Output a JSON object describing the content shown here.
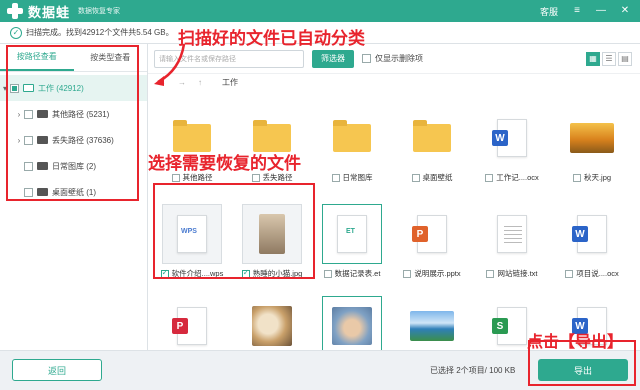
{
  "titlebar": {
    "app_name": "数据蛙",
    "app_subtitle": "数据恢复专家",
    "service_label": "客服",
    "menu_icon": "menu-icon",
    "minimize_icon": "minimize-icon",
    "close_icon": "close-icon"
  },
  "status": {
    "text": "扫描完成。找到42912个文件共5.54 GB。"
  },
  "sidebar": {
    "tabs": [
      "按路径查看",
      "按类型查看"
    ],
    "active_tab": "按路径查看",
    "root": {
      "label": "工作 (42912)"
    },
    "items": [
      {
        "label": "其他路径 (5231)",
        "expandable": true
      },
      {
        "label": "丢失路径 (37636)",
        "expandable": true
      },
      {
        "label": "日常图库 (2)",
        "expandable": false
      },
      {
        "label": "桌面壁纸 (1)",
        "expandable": false
      }
    ]
  },
  "toolbar": {
    "search_placeholder": "请输入文件名或保存路径",
    "filter_label": "筛选器",
    "only_deleted_label": "仅显示删除项",
    "views": [
      "grid-view-icon",
      "list-view-icon",
      "detail-view-icon"
    ]
  },
  "pathbar": {
    "current": "工作"
  },
  "files": [
    {
      "name": "其他路径",
      "type": "folder"
    },
    {
      "name": "丢失路径",
      "type": "folder"
    },
    {
      "name": "日常图库",
      "type": "folder"
    },
    {
      "name": "桌面壁纸",
      "type": "folder"
    },
    {
      "name": "工作记....ocx",
      "type": "word"
    },
    {
      "name": "秋天.jpg",
      "type": "photo-autumn"
    },
    {
      "name": "软件介绍....wps",
      "type": "wps",
      "checked": true
    },
    {
      "name": "熟睡的小猫.jpg",
      "type": "photo-cat-sleep",
      "checked": true
    },
    {
      "name": "数据记录表.et",
      "type": "et"
    },
    {
      "name": "说明展示.pptx",
      "type": "ppt"
    },
    {
      "name": "网站链接.txt",
      "type": "txt"
    },
    {
      "name": "项目说....ocx",
      "type": "word"
    },
    {
      "name": "",
      "type": "pdf"
    },
    {
      "name": "",
      "type": "photo-cats"
    },
    {
      "name": "",
      "type": "photo-rabbit"
    },
    {
      "name": "",
      "type": "photo-lake"
    },
    {
      "name": "",
      "type": "sheet"
    },
    {
      "name": "",
      "type": "word"
    }
  ],
  "footer": {
    "back_label": "返回",
    "selection_info": "已选择 2个项目/ 100 KB",
    "export_label": "导出"
  },
  "annotations": {
    "auto_classify": "扫描好的文件已自动分类",
    "select_files": "选择需要恢复的文件",
    "click_export": "点击【导出】"
  },
  "colors": {
    "accent": "#2ea98f",
    "annotation_red": "#e8242d"
  }
}
